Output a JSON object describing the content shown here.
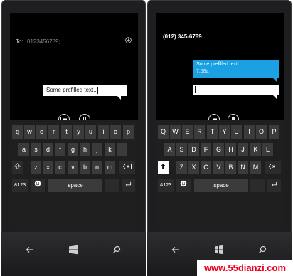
{
  "left_phone": {
    "to_label": "To:",
    "to_placeholder": "0123456789;",
    "message_text": "Some prefilled text..",
    "keyboard": {
      "row1": [
        "q",
        "w",
        "e",
        "r",
        "t",
        "y",
        "u",
        "i",
        "o",
        "p"
      ],
      "row2": [
        "a",
        "s",
        "d",
        "f",
        "g",
        "h",
        "j",
        "k",
        "l"
      ],
      "row3": [
        "z",
        "x",
        "c",
        "v",
        "b",
        "n",
        "m"
      ],
      "symbols_label": "&123",
      "space_label": "space"
    }
  },
  "right_phone": {
    "contact_number": "(012) 345-6789",
    "sent_message": "Some prefilled text..",
    "sent_time": "7:58a",
    "keyboard": {
      "row1": [
        "Q",
        "W",
        "E",
        "R",
        "T",
        "Y",
        "U",
        "I",
        "O",
        "P"
      ],
      "row2": [
        "A",
        "S",
        "D",
        "F",
        "G",
        "H",
        "J",
        "K",
        "L"
      ],
      "row3": [
        "Z",
        "X",
        "C",
        "V",
        "B",
        "N",
        "M"
      ],
      "symbols_label": "&123",
      "space_label": "space"
    }
  },
  "watermark": "www.55dianzi.com",
  "colors": {
    "accent": "#1ba1e2",
    "keyboard_key": "#3b3b3b",
    "screen_bg": "#000000",
    "watermark": "#e8001c"
  },
  "icons": [
    "add-contact-icon",
    "smiley-icon",
    "enter-icon",
    "backspace-icon",
    "send-icon",
    "attach-icon",
    "back-icon",
    "windows-start-icon",
    "search-icon"
  ]
}
